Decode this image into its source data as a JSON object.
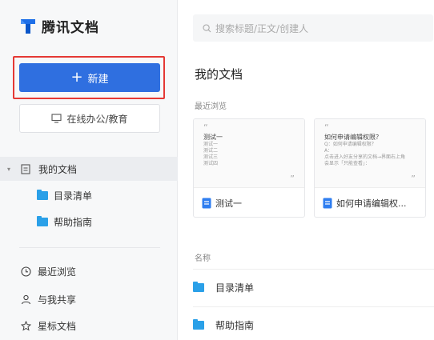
{
  "app": {
    "name": "腾讯文档",
    "brand_color": "#2f6fe0",
    "highlight_color": "#e53935"
  },
  "sidebar": {
    "new_button": "新建",
    "office_button": "在线办公/教育",
    "tree": {
      "root": "我的文档",
      "children": [
        "目录清单",
        "帮助指南"
      ]
    },
    "nav": [
      "最近浏览",
      "与我共享",
      "星标文档"
    ]
  },
  "main": {
    "search_placeholder": "搜索标题/正文/创建人",
    "title": "我的文档",
    "recent_label": "最近浏览",
    "cards": [
      {
        "title": "测试一",
        "preview_title": "测试一",
        "preview_lines": [
          "测试一",
          "测试二",
          "测试三",
          "测试四"
        ]
      },
      {
        "title": "如何申请编辑权...",
        "preview_title": "如何申请编辑权限？",
        "preview_lines": [
          "Q：如何申请编辑权限？",
          "A：",
          "点击进入好友分享的文档→界面右上角",
          "会显示「只能查看」："
        ]
      }
    ],
    "name_label": "名称",
    "folders": [
      "目录清单",
      "帮助指南"
    ]
  }
}
